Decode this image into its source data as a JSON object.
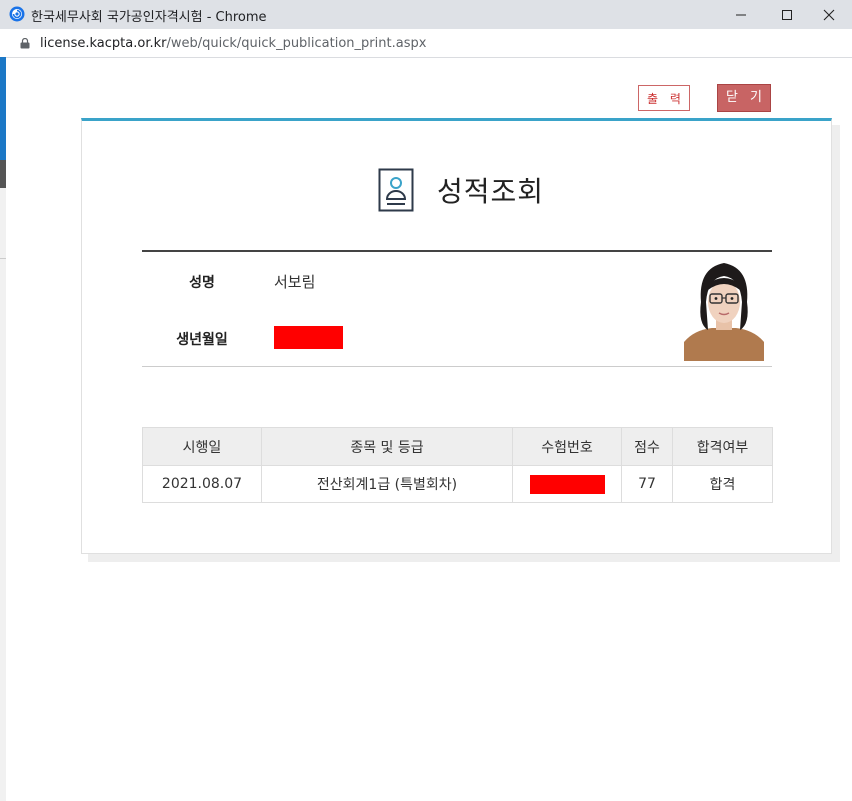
{
  "window": {
    "title": "한국세무사회 국가공인자격시험 - Chrome",
    "url_host": "license.kacpta.or.kr",
    "url_path": "/web/quick/quick_publication_print.aspx"
  },
  "toolbar": {
    "print_label": "출 력",
    "close_label": "닫 기"
  },
  "page": {
    "title": "성적조회"
  },
  "profile": {
    "name_label": "성명",
    "name_value": "서보림",
    "birth_label": "생년월일"
  },
  "results": {
    "headers": [
      "시행일",
      "종목 및 등급",
      "수험번호",
      "점수",
      "합격여부"
    ],
    "rows": [
      {
        "date": "2021.08.07",
        "subject": "전산회계1급 (특별회차)",
        "score": "77",
        "result": "합격"
      }
    ]
  },
  "colors": {
    "accent_top_border": "#3aa3c9",
    "close_button": "#c86464",
    "redaction": "#ff0000"
  }
}
